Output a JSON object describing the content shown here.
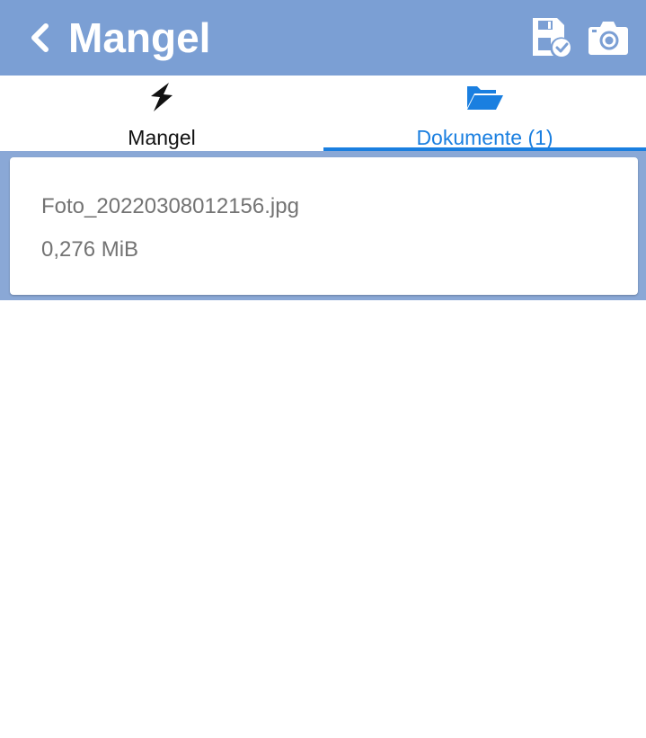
{
  "header": {
    "title": "Mangel",
    "back_icon": "chevron-left-icon",
    "actions": [
      {
        "name": "save",
        "icon": "save-check-icon"
      },
      {
        "name": "camera",
        "icon": "camera-icon"
      }
    ],
    "background_color": "#7b9fd4"
  },
  "tabs": [
    {
      "label": "Mangel",
      "icon": "lightning-icon",
      "active": false
    },
    {
      "label": "Dokumente (1)",
      "icon": "folder-open-icon",
      "active": true
    }
  ],
  "accent_color": "#1a7fe0",
  "documents": [
    {
      "name": "Foto_20220308012156.jpg",
      "size": "0,276 MiB"
    }
  ]
}
